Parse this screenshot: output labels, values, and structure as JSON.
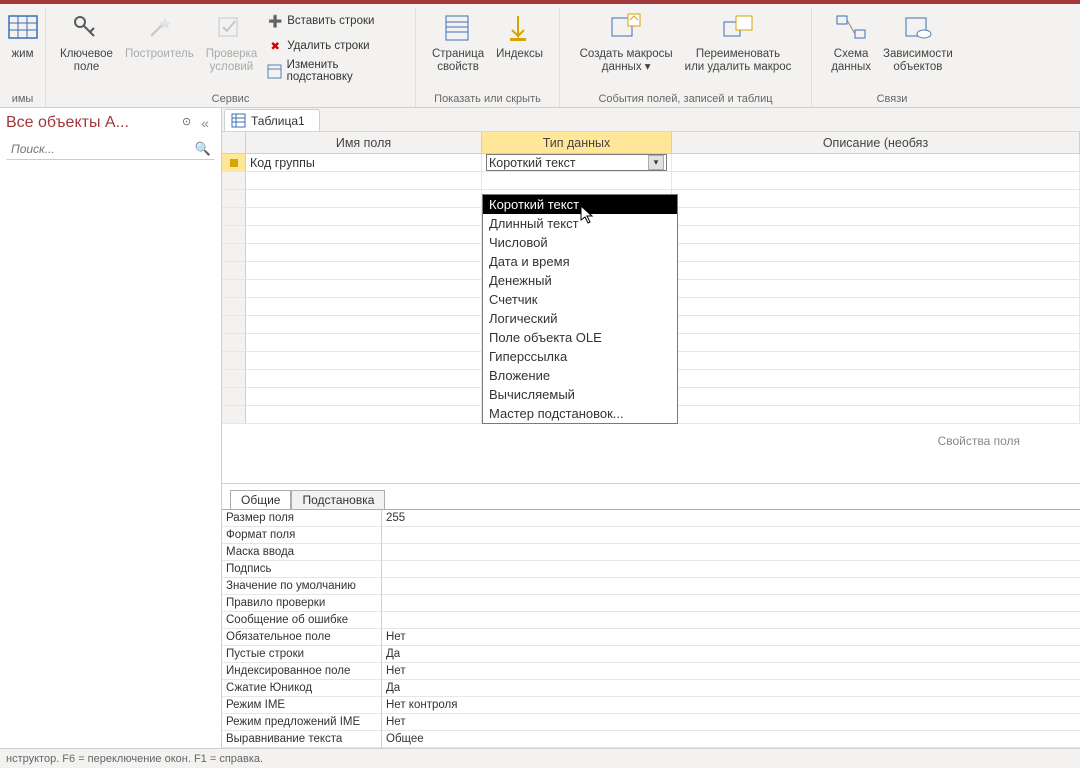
{
  "ribbon": {
    "view_mode": "жим",
    "key_field": "Ключевое\nполе",
    "builder": "Построитель",
    "validation": "Проверка\nусловий",
    "insert_rows": "Вставить строки",
    "delete_rows": "Удалить строки",
    "modify_lookup": "Изменить подстановку",
    "group_views": "имы",
    "group_service": "Сервис",
    "property_sheet": "Страница\nсвойств",
    "indexes": "Индексы",
    "group_showhide": "Показать или скрыть",
    "create_macros": "Создать макросы\nданных ▾",
    "rename_delete": "Переименовать\nили удалить макрос",
    "group_events": "События полей, записей и таблиц",
    "relationships": "Схема\nданных",
    "dependencies": "Зависимости\nобъектов",
    "group_relations": "Связи"
  },
  "sidebar": {
    "title": "Все объекты A...",
    "search_placeholder": "Поиск..."
  },
  "doc": {
    "tab": "Таблица1",
    "col_field": "Имя поля",
    "col_type": "Тип данных",
    "col_desc": "Описание (необяз",
    "field_name": "Код группы",
    "type_value": "Короткий текст",
    "type_options": [
      "Короткий текст",
      "Длинный текст",
      "Числовой",
      "Дата и время",
      "Денежный",
      "Счетчик",
      "Логический",
      "Поле объекта OLE",
      "Гиперссылка",
      "Вложение",
      "Вычисляемый",
      "Мастер подстановок..."
    ],
    "props_label": "Свойства поля"
  },
  "props": {
    "tab_general": "Общие",
    "tab_lookup": "Подстановка",
    "rows": [
      {
        "n": "Размер поля",
        "v": "255"
      },
      {
        "n": "Формат поля",
        "v": ""
      },
      {
        "n": "Маска ввода",
        "v": ""
      },
      {
        "n": "Подпись",
        "v": ""
      },
      {
        "n": "Значение по умолчанию",
        "v": ""
      },
      {
        "n": "Правило проверки",
        "v": ""
      },
      {
        "n": "Сообщение об ошибке",
        "v": ""
      },
      {
        "n": "Обязательное поле",
        "v": "Нет"
      },
      {
        "n": "Пустые строки",
        "v": "Да"
      },
      {
        "n": "Индексированное поле",
        "v": "Нет"
      },
      {
        "n": "Сжатие Юникод",
        "v": "Да"
      },
      {
        "n": "Режим IME",
        "v": "Нет контроля"
      },
      {
        "n": "Режим предложений IME",
        "v": "Нет"
      },
      {
        "n": "Выравнивание текста",
        "v": "Общее"
      }
    ]
  },
  "status": "нструктор.  F6 = переключение окон.  F1 = справка."
}
